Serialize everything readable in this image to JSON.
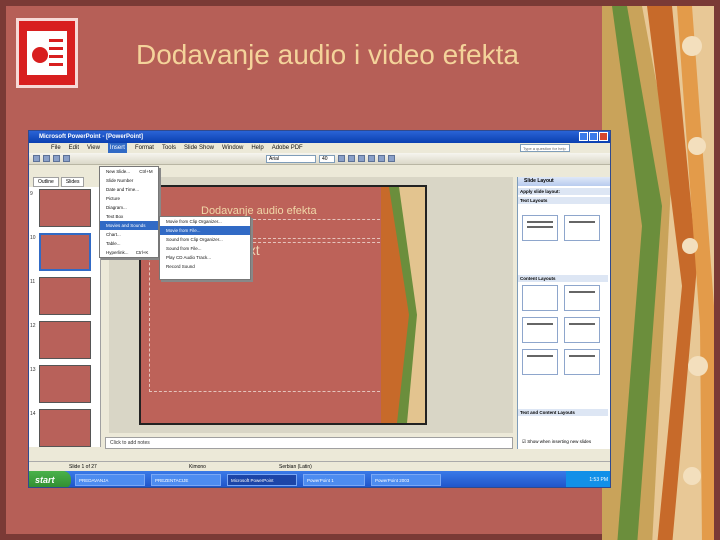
{
  "slide": {
    "title": "Dodavanje audio i video efekta"
  },
  "window": {
    "title": "Microsoft PowerPoint - [PowerPoint]",
    "menu": [
      "File",
      "Edit",
      "View",
      "Insert",
      "Format",
      "Tools",
      "Slide Show",
      "Window",
      "Help",
      "Adobe PDF"
    ],
    "font_name": "Arial",
    "font_size": "40",
    "search_placeholder": "Type a question for help"
  },
  "left_pane": {
    "tabs": [
      "Outline",
      "Slides"
    ],
    "slide_numbers": [
      "9",
      "10",
      "11",
      "12",
      "13",
      "14"
    ]
  },
  "insert_menu": {
    "items": [
      "New Slide...",
      "Slide Number",
      "Date and Time...",
      "Picture",
      "Diagram...",
      "Text Box",
      "Movies and Sounds",
      "Chart...",
      "Table...",
      "Hyperlink..."
    ],
    "shortcuts": {
      "new_slide": "Ctrl+M",
      "hyperlink": "Ctrl+K"
    }
  },
  "movies_menu": {
    "items": [
      "Movie from Clip Organizer...",
      "Movie from File...",
      "Sound from Clip Organizer...",
      "Sound from File...",
      "Play CD Audio Track...",
      "Record Sound"
    ]
  },
  "editor": {
    "slide_title": "Dodavanje audio efekta",
    "body_fragment": "ext",
    "notes_placeholder": "Click to add notes"
  },
  "task_pane": {
    "header": "Slide Layout",
    "apply_label": "Apply slide layout:",
    "sections": [
      "Text Layouts",
      "Content Layouts",
      "Text and Content Layouts"
    ],
    "show_checkbox": "Show when inserting new slides"
  },
  "status": {
    "slide_of": "Slide 1 of 27",
    "design": "Kimono",
    "language": "Serbian (Latin)"
  },
  "taskbar": {
    "start": "start",
    "tasks": [
      "PREDAVANJA",
      "PREZENTACIJE",
      "Microsoft PowerPoint",
      "PowerPoint 1",
      "PowerPoint 2003"
    ],
    "time": "1:53 PM"
  },
  "colors": {
    "slide_bg": "#b65f57",
    "title_text": "#f4d39a",
    "logo_red": "#d81f1f"
  }
}
